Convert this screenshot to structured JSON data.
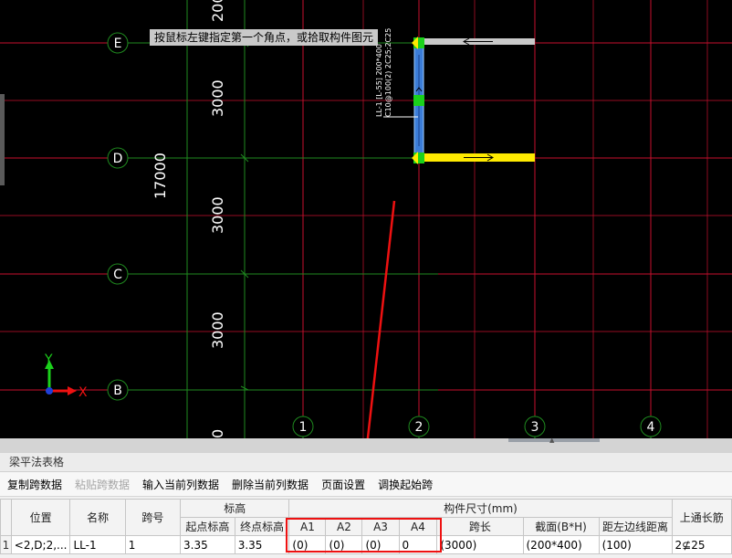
{
  "canvas": {
    "tooltip": "按鼠标左键指定第一个角点，或拾取构件图元",
    "axis_rows": [
      "E",
      "D",
      "C",
      "B"
    ],
    "axis_cols": [
      "1",
      "2",
      "3",
      "4"
    ],
    "dimensions": {
      "top_partial": "200",
      "span_ed": "3000",
      "span_dc": "3000",
      "span_cb": "3000",
      "total": "17000",
      "bottom_partial": "0"
    },
    "beam_annotation": {
      "line1": "LL-1 [L-55] 200*400",
      "line2": "C10@100(2) 2C25;2C25"
    },
    "ucs": {
      "y": "Y",
      "x": "X"
    }
  },
  "panel": {
    "title": "梁平法表格",
    "toolbar": {
      "copy": "复制跨数据",
      "paste": "粘贴跨数据",
      "input_col": "输入当前列数据",
      "delete_col": "删除当前列数据",
      "page_setup": "页面设置",
      "swap_span": "调换起始跨"
    },
    "headers": {
      "position": "位置",
      "name": "名称",
      "span_no": "跨号",
      "elevation": "标高",
      "start_elev": "起点标高",
      "end_elev": "终点标高",
      "size_group": "构件尺寸(mm)",
      "a1": "A1",
      "a2": "A2",
      "a3": "A3",
      "a4": "A4",
      "span_len": "跨长",
      "section": "截面(B*H)",
      "left_dist": "距左边线距离",
      "top_long": "上通长筋"
    },
    "rows": [
      {
        "num": "1",
        "position": "<2,D;2,...",
        "name": "LL-1",
        "span_no": "1",
        "start_elev": "3.35",
        "end_elev": "3.35",
        "a1": "(0)",
        "a2": "(0)",
        "a3": "(0)",
        "a4": "0",
        "span_len": "(3000)",
        "section": "(200*400)",
        "left_dist": "(100)",
        "top_long": "2⊈25"
      }
    ]
  }
}
